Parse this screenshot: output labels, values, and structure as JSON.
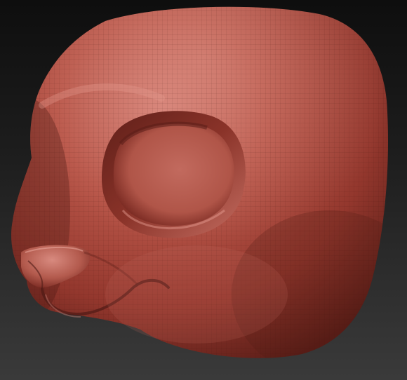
{
  "viewport": {
    "background_top": "#0e0e0e",
    "background_bottom": "#3a3a3a"
  },
  "model": {
    "subject": "sculpted-cartoon-animal-head",
    "material_base": "#a8463c",
    "material_highlight": "#d9867b",
    "material_shadow": "#4e1a15",
    "wireframe_visible": true
  }
}
